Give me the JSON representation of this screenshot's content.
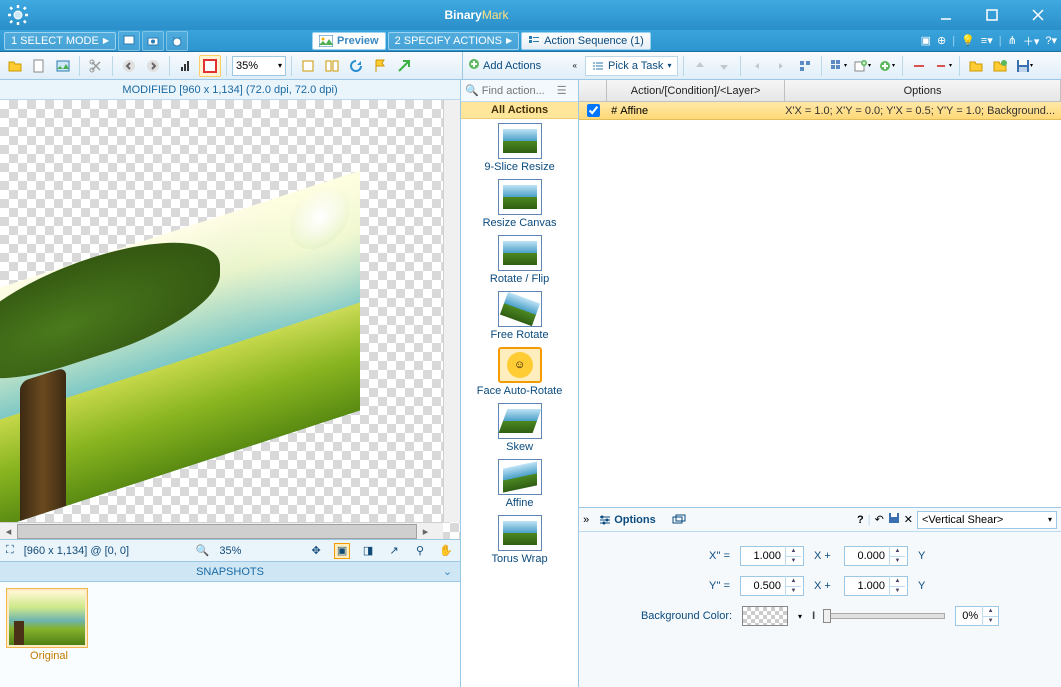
{
  "titlebar": {
    "brand_a": "Binary",
    "brand_b": "Mark"
  },
  "ribbon": {
    "step1": "1  SELECT MODE",
    "preview": "Preview",
    "step2": "2  SPECIFY ACTIONS",
    "sequence": "Action Sequence (1)"
  },
  "toolbar_left": {
    "zoom": "35%"
  },
  "preview": {
    "header": "MODIFIED [960 x 1,134] (72.0 dpi, 72.0 dpi)",
    "status_dims": "[960 x 1,134] @ [0, 0]",
    "status_zoom": "35%"
  },
  "snapshots": {
    "title": "SNAPSHOTS",
    "thumb_label": "Original"
  },
  "action_panel": {
    "search_placeholder": "Find action...",
    "all_actions": "All Actions",
    "add_actions": "Add Actions",
    "pick_task": "Pick a Task",
    "items": [
      {
        "label": "9-Slice Resize"
      },
      {
        "label": "Resize Canvas"
      },
      {
        "label": "Rotate / Flip"
      },
      {
        "label": "Free Rotate"
      },
      {
        "label": "Face Auto-Rotate"
      },
      {
        "label": "Skew"
      },
      {
        "label": "Affine"
      },
      {
        "label": "Torus Wrap"
      }
    ]
  },
  "grid": {
    "col_action": "Action/[Condition]/<Layer>",
    "col_options": "Options",
    "row_name": "Affine",
    "row_opts": "X'X = 1.0; X'Y = 0.0; Y'X = 0.5; Y'Y = 1.0; Background..."
  },
  "options": {
    "tab_label": "Options",
    "preset": "<Vertical Shear>",
    "xprime": "X'' =",
    "yprime": "Y'' =",
    "x_plus": "X +",
    "y_suffix": "Y",
    "v_xx": "1.000",
    "v_xy": "0.000",
    "v_yx": "0.500",
    "v_yy": "1.000",
    "bg_label": "Background Color:",
    "bg_pct": "0%"
  }
}
